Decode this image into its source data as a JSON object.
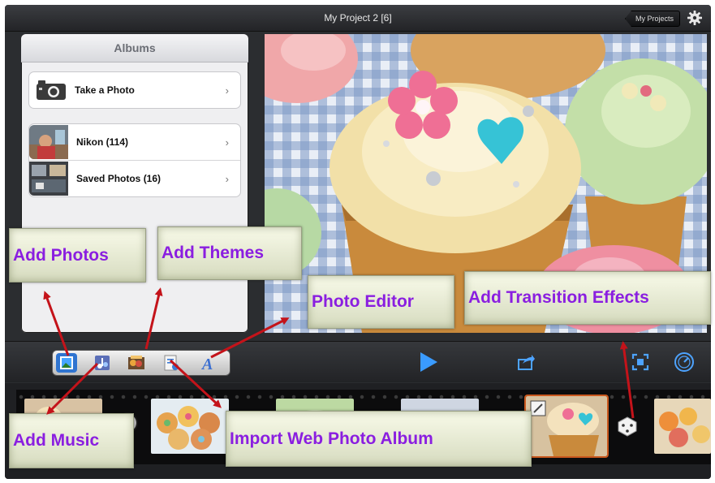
{
  "topbar": {
    "project_title": "My Project 2  [6]",
    "my_projects_label": "My Projects",
    "settings_icon": "gear-icon"
  },
  "albums": {
    "header": "Albums",
    "take_photo_label": "Take a Photo",
    "items": [
      {
        "label": "Nikon (114)"
      },
      {
        "label": "Saved Photos (16)"
      }
    ]
  },
  "toolbar": {
    "tools": [
      "add-photos-icon",
      "add-music-icon",
      "add-themes-icon",
      "import-web-album-icon",
      "photo-editor-icon"
    ],
    "play_icon": "play-icon",
    "share_icon": "share-icon",
    "crop_icon": "crop-icon",
    "speed_icon": "speed-icon"
  },
  "callouts": {
    "add_photos": "Add Photos",
    "add_themes": "Add Themes",
    "photo_editor": "Photo Editor",
    "add_transition": "Add Transition Effects",
    "add_music": "Add Music",
    "import_web": "Import Web Photo Album"
  },
  "colors": {
    "callout_text": "#8a1ee0",
    "arrow": "#c4131a",
    "accent": "#2f74d0",
    "play": "#3a9bff"
  }
}
